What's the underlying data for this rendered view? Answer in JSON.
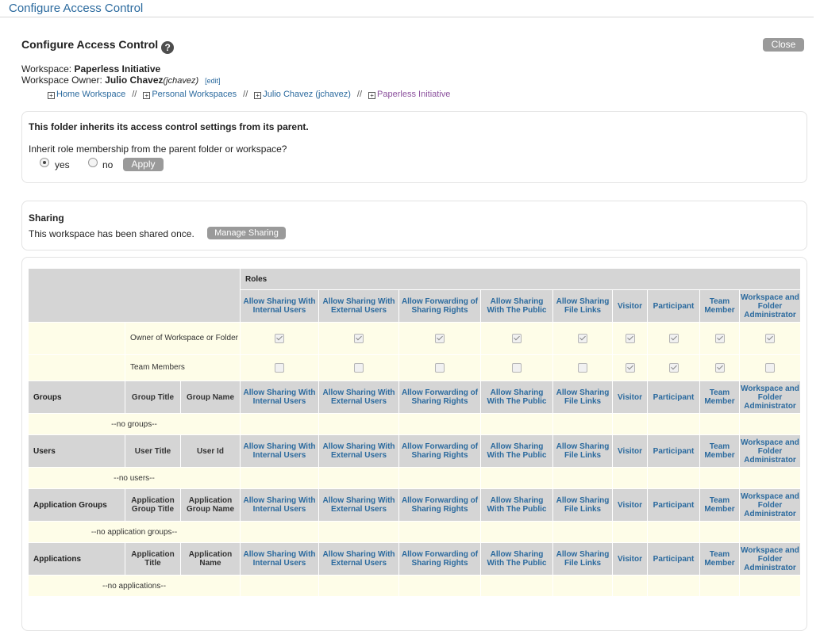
{
  "app_title": "Configure Access Control",
  "page_title": "Configure Access Control",
  "help_glyph": "?",
  "close_label": "Close",
  "workspace": {
    "label": "Workspace:",
    "name": "Paperless Initiative"
  },
  "owner": {
    "label": "Workspace Owner:",
    "name": "Julio Chavez",
    "user": "(jchavez)",
    "edit": "[edit]"
  },
  "breadcrumbs": {
    "items": [
      "Home Workspace",
      "Personal Workspaces",
      "Julio Chavez (jchavez)",
      "Paperless Initiative"
    ],
    "separator": "//",
    "expand_glyph": "+"
  },
  "inherit": {
    "heading": "This folder inherits its access control settings from its parent.",
    "question": "Inherit role membership from the parent folder or workspace?",
    "yes_label": "yes",
    "no_label": "no",
    "selected": "yes",
    "apply_label": "Apply"
  },
  "sharing": {
    "heading": "Sharing",
    "text": "This workspace has been shared once.",
    "manage_label": "Manage Sharing"
  },
  "roles_title": "Roles",
  "role_columns": [
    "Allow Sharing With Internal Users",
    "Allow Sharing With External Users",
    "Allow Forwarding of Sharing Rights",
    "Allow Sharing With The Public",
    "Allow Sharing File Links",
    "Visitor",
    "Participant",
    "Team Member",
    "Workspace and Folder Administrator"
  ],
  "member_rows": [
    {
      "label": "Owner of Workspace or Folder",
      "checks": [
        true,
        true,
        true,
        true,
        true,
        true,
        true,
        true,
        true
      ]
    },
    {
      "label": "Team Members",
      "checks": [
        false,
        false,
        false,
        false,
        false,
        true,
        true,
        true,
        false
      ]
    }
  ],
  "sections": [
    {
      "title": "Groups",
      "col1": "Group Title",
      "col2": "Group Name",
      "empty": "--no groups--"
    },
    {
      "title": "Users",
      "col1": "User Title",
      "col2": "User Id",
      "empty": "--no users--"
    },
    {
      "title": "Application Groups",
      "col1": "Application Group Title",
      "col2": "Application Group Name",
      "empty": "--no application groups--"
    },
    {
      "title": "Applications",
      "col1": "Application Title",
      "col2": "Application Name",
      "empty": "--no applications--"
    }
  ],
  "colors": {
    "accent": "#2b6a9e",
    "visited": "#8a4f9c",
    "header_bg": "#d5d5d5",
    "row_bg": "#fefde8"
  }
}
